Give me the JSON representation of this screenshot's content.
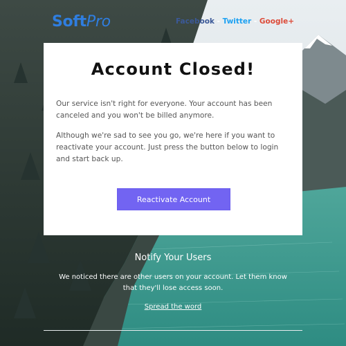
{
  "brand": {
    "name_bold": "Soft",
    "name_italic": "Pro",
    "color": "#2f7ee0"
  },
  "social": {
    "facebook": "Facebook",
    "twitter": "Twitter",
    "googleplus": "Google+",
    "separator": " - "
  },
  "card": {
    "title": "Account Closed!",
    "paragraph_1": "Our service isn't right for everyone. Your account has been canceled and you won't be billed anymore.",
    "paragraph_2": "Although we're sad to see you go, we're here if you want to reactivate your account. Just press the button below to login and start back up.",
    "button_label": "Reactivate Account",
    "button_color": "#7264f2"
  },
  "notify": {
    "title": "Notify Your Users",
    "text": "We noticed there are other users on your account. Let them know that they'll lose access soon.",
    "link": "Spread the word"
  }
}
